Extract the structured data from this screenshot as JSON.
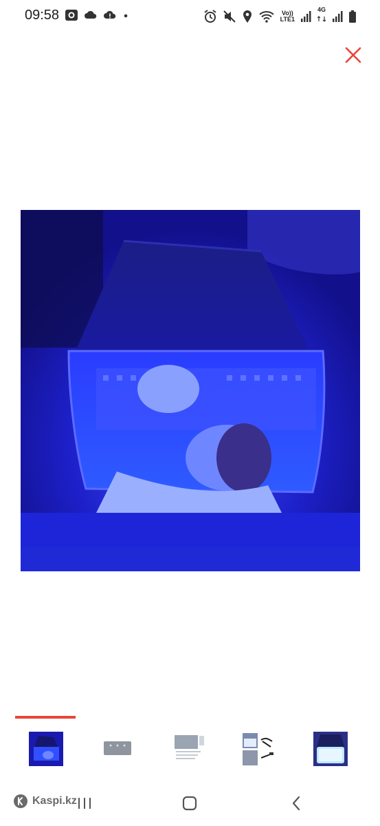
{
  "status_bar": {
    "time": "09:58",
    "network_label": "LTE1",
    "volte_label": "Vo))",
    "network_type": "4G",
    "left_icons": [
      "gallery-icon",
      "cloud-icon",
      "cloud-alert-icon",
      "dot-icon"
    ],
    "right_icons": [
      "alarm-icon",
      "mute-icon",
      "location-icon",
      "wifi-icon",
      "signal-icon",
      "signal-icon",
      "battery-icon"
    ]
  },
  "viewer": {
    "close_icon": "close-icon",
    "accent_color": "#e8453a",
    "selected_index": 0,
    "thumbnails": [
      {
        "name": "thumbnail-1",
        "selected": true
      },
      {
        "name": "thumbnail-2",
        "selected": false
      },
      {
        "name": "thumbnail-3",
        "selected": false
      },
      {
        "name": "thumbnail-4",
        "selected": false
      },
      {
        "name": "thumbnail-5",
        "selected": false
      }
    ]
  },
  "nav_bar": {
    "app_label": "Kaspi.kz",
    "icons": [
      "recent-apps-icon",
      "home-icon",
      "back-icon"
    ]
  }
}
